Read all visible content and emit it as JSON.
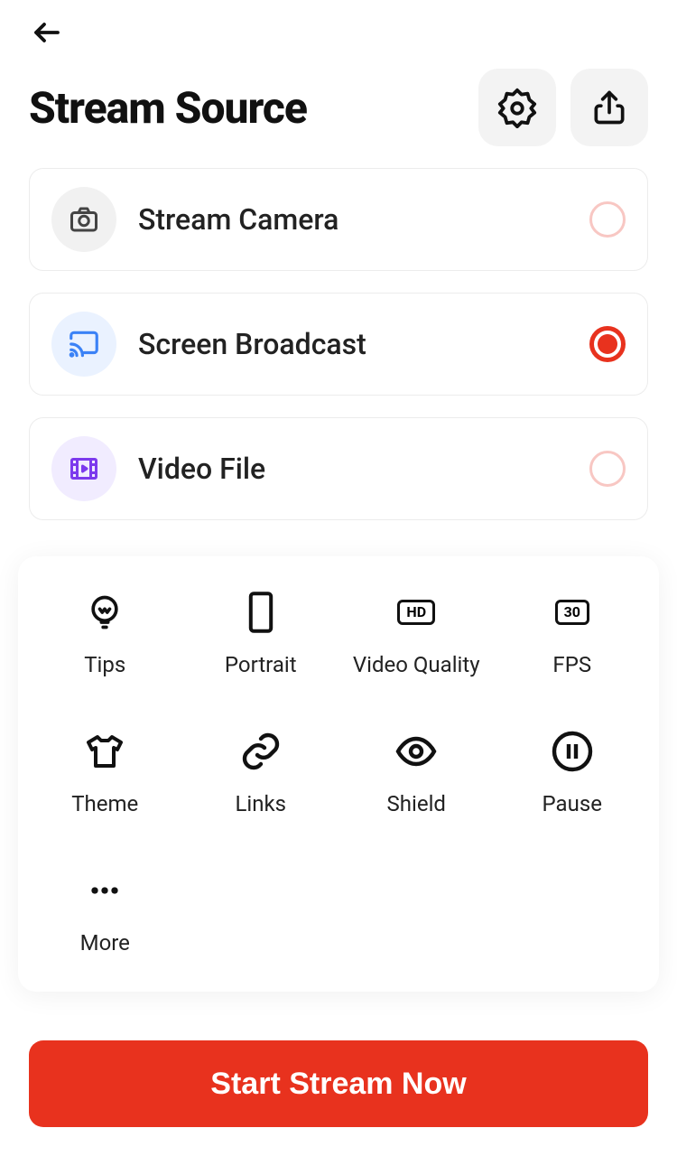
{
  "header": {
    "title": "Stream Source"
  },
  "sources": [
    {
      "label": "Stream Camera",
      "selected": false
    },
    {
      "label": "Screen Broadcast",
      "selected": true
    },
    {
      "label": "Video File",
      "selected": false
    }
  ],
  "options": [
    {
      "label": "Tips"
    },
    {
      "label": "Portrait"
    },
    {
      "label": "Video Quality",
      "badge": "HD"
    },
    {
      "label": "FPS",
      "badge": "30"
    },
    {
      "label": "Theme"
    },
    {
      "label": "Links"
    },
    {
      "label": "Shield"
    },
    {
      "label": "Pause"
    },
    {
      "label": "More"
    }
  ],
  "cta": {
    "label": "Start Stream Now"
  }
}
